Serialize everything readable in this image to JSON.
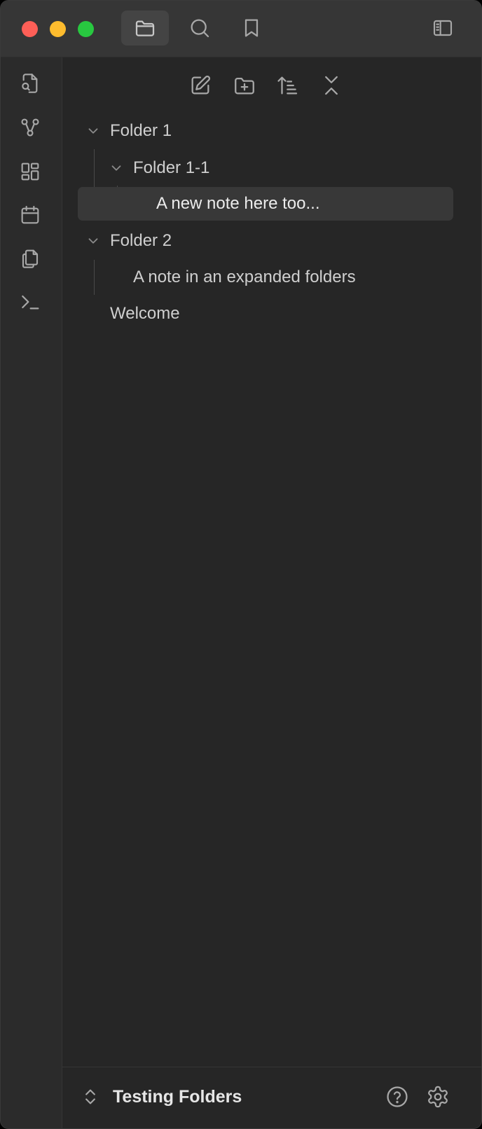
{
  "colors": {
    "traffic_close": "#fe5f57",
    "traffic_minimize": "#febc2e",
    "traffic_zoom": "#28c840",
    "icon": "#a8a8a8",
    "chevron": "#8a8a8a"
  },
  "titlebar": {
    "tabs": [
      {
        "icon": "folder-icon",
        "active": true
      },
      {
        "icon": "search-icon",
        "active": false
      },
      {
        "icon": "bookmark-icon",
        "active": false
      }
    ],
    "right_icon": "sidebar-toggle-icon"
  },
  "ribbon": {
    "items": [
      {
        "icon": "file-search-icon"
      },
      {
        "icon": "graph-icon"
      },
      {
        "icon": "layout-dashboard-icon"
      },
      {
        "icon": "calendar-icon"
      },
      {
        "icon": "copy-icon"
      },
      {
        "icon": "terminal-icon"
      }
    ]
  },
  "explorer": {
    "actions": [
      {
        "icon": "new-note-icon"
      },
      {
        "icon": "new-folder-icon"
      },
      {
        "icon": "sort-icon"
      },
      {
        "icon": "collapse-all-icon"
      }
    ],
    "tree": [
      {
        "label": "Folder 1",
        "type": "folder",
        "expanded": true,
        "depth": 0
      },
      {
        "label": "Folder 1-1",
        "type": "folder",
        "expanded": true,
        "depth": 1
      },
      {
        "label": "A new note here too...",
        "type": "note",
        "depth": 2,
        "selected": true
      },
      {
        "label": "Folder 2",
        "type": "folder",
        "expanded": true,
        "depth": 0
      },
      {
        "label": "A note in an expanded folders",
        "type": "note",
        "depth": 1
      },
      {
        "label": "Welcome",
        "type": "note",
        "depth": 0
      }
    ]
  },
  "footer": {
    "vault_name": "Testing Folders",
    "switch_icon": "chevrons-up-down-icon",
    "help_icon": "help-icon",
    "settings_icon": "gear-icon"
  }
}
